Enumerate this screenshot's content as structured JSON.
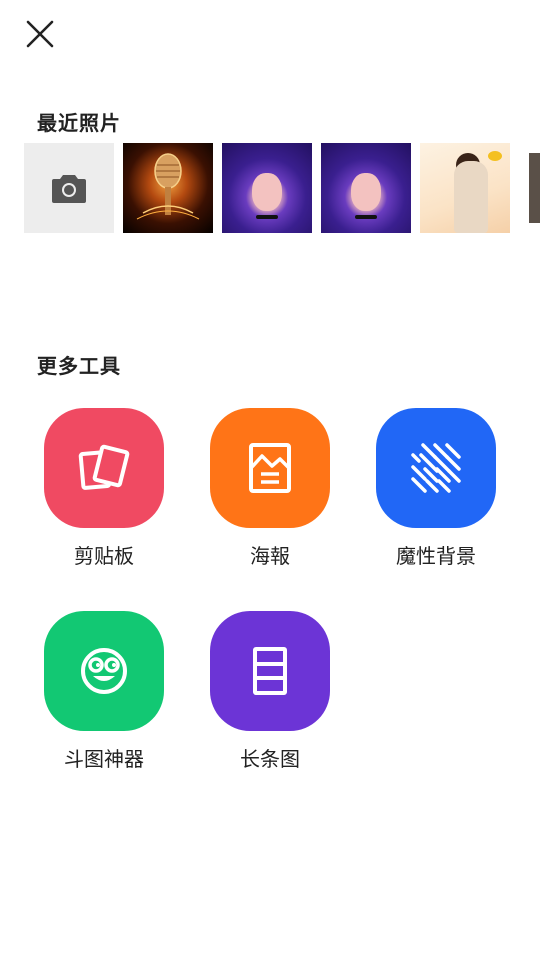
{
  "header": {
    "close_icon": "close-icon"
  },
  "recent": {
    "title": "最近照片",
    "camera_icon": "camera-icon",
    "thumbnails": [
      {
        "subject": "microphone"
      },
      {
        "subject": "purple-hair-girl"
      },
      {
        "subject": "purple-hair-girl"
      },
      {
        "subject": "woman-portrait"
      },
      {
        "subject": "partial-photo"
      }
    ]
  },
  "more_tools": {
    "title": "更多工具",
    "items": [
      {
        "label": "剪贴板",
        "icon": "clipboard-cards-icon",
        "color": "#F04A62"
      },
      {
        "label": "海報",
        "icon": "poster-icon",
        "color": "#FF7417"
      },
      {
        "label": "魔性背景",
        "icon": "diagonal-stripes-icon",
        "color": "#2167F6"
      },
      {
        "label": "斗图神器",
        "icon": "smiley-face-icon",
        "color": "#12C873"
      },
      {
        "label": "长条图",
        "icon": "long-image-icon",
        "color": "#6C34D6"
      }
    ]
  }
}
